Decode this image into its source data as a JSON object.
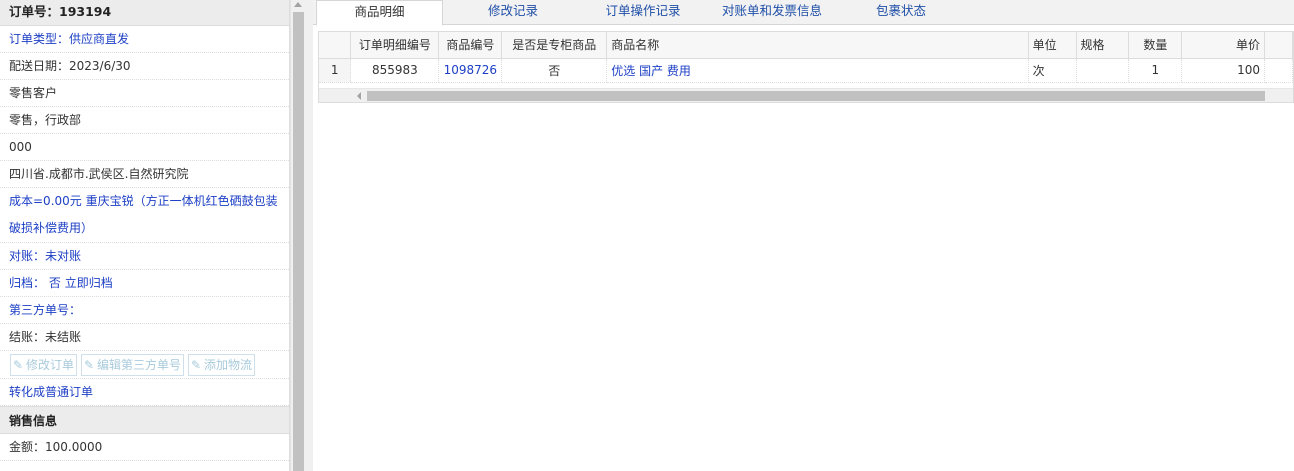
{
  "left": {
    "order_title": "订单号：193194",
    "order_type": "订单类型：供应商直发",
    "delivery_date": "配送日期：2023/6/30",
    "customer": "零售客户",
    "dept": "零售，行政部",
    "code": "000",
    "address": "四川省.成都市.武侯区.自然研究院",
    "cost": "成本=0.00元 重庆宝锐（方正一体机红色硒鼓包装破损补偿费用）",
    "reconcile": "对账：未对账",
    "archive_label": "归档：",
    "archive_value": "否",
    "archive_link": "立即归档",
    "third_party": "第三方单号：",
    "settle": "结账：未结账",
    "btn_edit_order": "修改订单",
    "btn_edit_third": "编辑第三方单号",
    "btn_add_logistics": "添加物流",
    "convert": "转化成普通订单",
    "sales_header": "销售信息",
    "amount": "金额：100.0000"
  },
  "tabs": [
    "商品明细",
    "修改记录",
    "订单操作记录",
    "对账单和发票信息",
    "包裹状态"
  ],
  "grid": {
    "headers": [
      "订单明细编号",
      "商品编号",
      "是否是专柜商品",
      "商品名称",
      "单位",
      "规格",
      "数量",
      "单价"
    ],
    "rows": [
      {
        "num": "1",
        "detail_id": "855983",
        "product_id": "1098726",
        "is_counter": "否",
        "name": "优选 国产 费用",
        "unit": "次",
        "spec": "",
        "qty": "1",
        "price": "100"
      }
    ]
  }
}
